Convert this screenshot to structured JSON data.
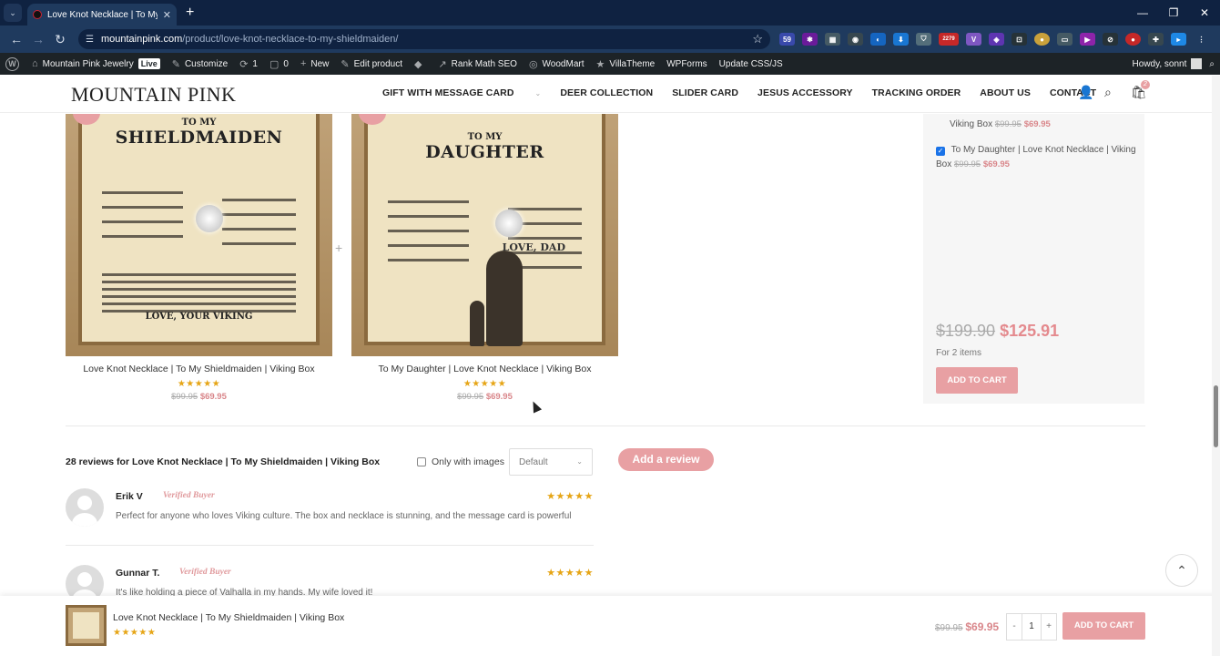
{
  "browser": {
    "tab_title": "Love Knot Necklace | To My Sh",
    "url_host": "mountainpink.com",
    "url_path": "/product/love-knot-necklace-to-my-shieldmaiden/",
    "badge_59": "59",
    "badge_2279": "2279"
  },
  "wpbar": {
    "site": "Mountain Pink Jewelry",
    "live": "Live",
    "customize": "Customize",
    "updates": "1",
    "comments": "0",
    "new": "New",
    "edit_product": "Edit product",
    "rank_math": "Rank Math SEO",
    "woodmart": "WoodMart",
    "villatheme": "VillaTheme",
    "wpforms": "WPForms",
    "update_css": "Update CSS/JS",
    "howdy": "Howdy, sonnt"
  },
  "header": {
    "logo": "MOUNTAIN PINK",
    "nav": [
      "GIFT WITH MESSAGE CARD",
      "DEER COLLECTION",
      "SLIDER CARD",
      "JESUS ACCESSORY",
      "TRACKING ORDER",
      "ABOUT US",
      "CONTACT"
    ],
    "cart_count": "2"
  },
  "products": [
    {
      "card_top": "TO MY",
      "card_title": "SHIELDMAIDEN",
      "card_sign": "LOVE, YOUR VIKING",
      "name": "Love Knot Necklace | To My Shieldmaiden | Viking Box",
      "stars": "★★★★★",
      "old_price": "$99.95",
      "new_price": "$69.95"
    },
    {
      "card_top": "TO MY",
      "card_title": "DAUGHTER",
      "card_sign": "LOVE, DAD",
      "name": "To My Daughter | Love Knot Necklace | Viking Box",
      "stars": "★★★★★",
      "old_price": "$99.95",
      "new_price": "$69.95"
    }
  ],
  "bundle": {
    "item1_name": "Viking Box",
    "item1_old": "$99.95",
    "item1_new": "$69.95",
    "item2_name": "To My Daughter | Love Knot Necklace | Viking Box",
    "item2_old": "$99.95",
    "item2_new": "$69.95",
    "total_old": "$199.90",
    "total_new": "$125.91",
    "for_items": "For 2 items",
    "add_to_cart": "ADD TO CART"
  },
  "reviews": {
    "heading": "28 reviews for Love Knot Necklace | To My Shieldmaiden | Viking Box",
    "only_images": "Only with images",
    "sort_value": "Default",
    "add_review": "Add a review",
    "items": [
      {
        "name": "Erik V",
        "badge": "Verified Buyer",
        "stars": "★★★★★",
        "text": "Perfect for anyone who loves Viking culture. The box and necklace is stunning, and the message card is powerful"
      },
      {
        "name": "Gunnar T.",
        "badge": "Verified Buyer",
        "stars": "★★★★★",
        "text": "It's like holding a piece of Valhalla in my hands. My wife loved it!"
      }
    ]
  },
  "sticky": {
    "name": "Love Knot Necklace | To My Shieldmaiden | Viking Box",
    "stars": "★★★★★",
    "old_price": "$99.95",
    "new_price": "$69.95",
    "qty_minus": "-",
    "qty": "1",
    "qty_plus": "+",
    "add_to_cart": "ADD TO CART"
  }
}
